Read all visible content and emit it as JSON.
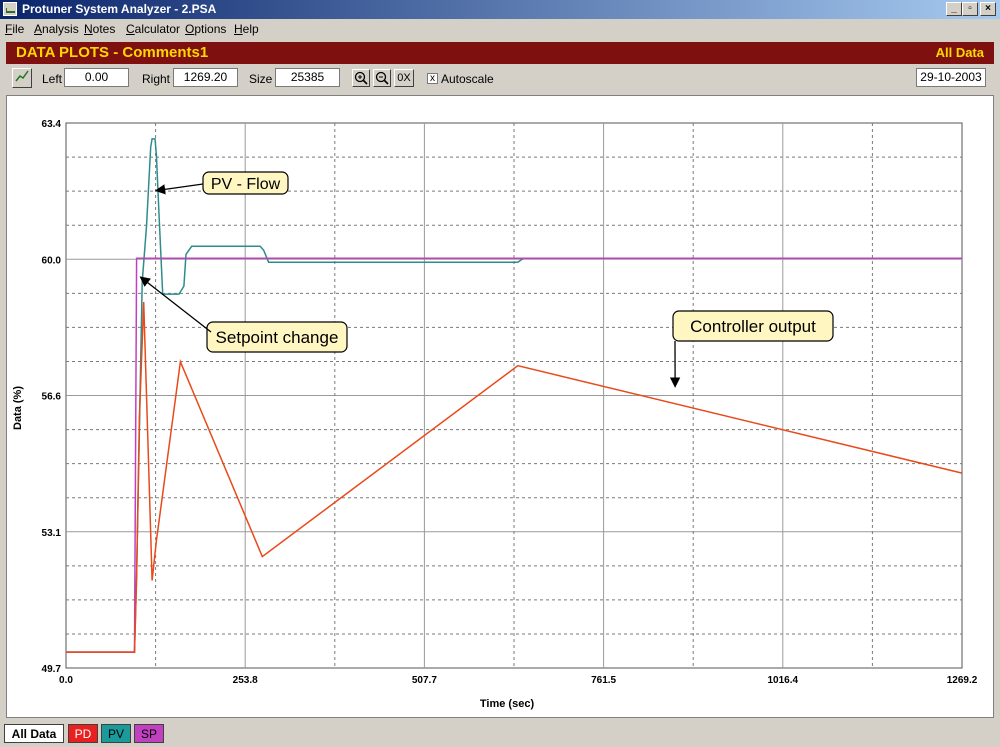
{
  "window": {
    "title": "Protuner System Analyzer - 2.PSA"
  },
  "menu": [
    "File",
    "Analysis",
    "Notes",
    "Calculator",
    "Options",
    "Help"
  ],
  "banner": {
    "title": "DATA PLOTS - Comments1",
    "right": "All Data"
  },
  "toolbar": {
    "left_label": "Left",
    "left_value": "0.00",
    "right_label": "Right",
    "right_value": "1269.20",
    "size_label": "Size",
    "size_value": "25385",
    "zoom_in": "+",
    "zoom_out": "-",
    "reset": "0X",
    "autoscale_checked": "x",
    "autoscale_label": "Autoscale",
    "date": "29-10-2003"
  },
  "tabs": [
    {
      "label": "All Data",
      "bg": "#ffffff",
      "fg": "#000000"
    },
    {
      "label": "PD",
      "bg": "#e82020",
      "fg": "#ffffff"
    },
    {
      "label": "PV",
      "bg": "#1a9a9a",
      "fg": "#000000"
    },
    {
      "label": "SP",
      "bg": "#c040c0",
      "fg": "#000000"
    }
  ],
  "chart_data": {
    "type": "line",
    "xlabel": "Time (sec)",
    "ylabel": "Data (%)",
    "xlim": [
      0,
      1269.2
    ],
    "ylim": [
      49.7,
      63.4
    ],
    "x_ticks": [
      "0.0",
      "253.8",
      "507.7",
      "761.5",
      "1016.4",
      "1269.2"
    ],
    "y_ticks": [
      "49.7",
      "53.1",
      "56.6",
      "60.0",
      "63.4"
    ],
    "grid": true,
    "series": [
      {
        "name": "PD",
        "color": "#e84a1a",
        "x": [
          0,
          97,
          100,
          104,
          110,
          122,
          128,
          162,
          278,
          640,
          1269.2
        ],
        "y": [
          50.1,
          50.1,
          52.0,
          56.0,
          58.9,
          51.9,
          52.9,
          57.4,
          52.5,
          57.3,
          54.6
        ]
      },
      {
        "name": "PV",
        "color": "#2f8c8c",
        "x": [
          0,
          97,
          100,
          108,
          114,
          120,
          122,
          124,
          126,
          128,
          132,
          137,
          160,
          167,
          170,
          178,
          205,
          275,
          280,
          287,
          300,
          640,
          648,
          1269.2
        ],
        "y": [
          50.1,
          50.1,
          52.0,
          59.4,
          60.8,
          62.8,
          63.0,
          63.0,
          63.0,
          62.6,
          61.0,
          59.1,
          59.1,
          59.3,
          60.1,
          60.3,
          60.3,
          60.3,
          60.2,
          59.9,
          59.9,
          59.9,
          60.0,
          60.0
        ]
      },
      {
        "name": "SP",
        "color": "#c040c0",
        "x": [
          0,
          97,
          100,
          1269.2
        ],
        "y": [
          50.1,
          50.1,
          60.0,
          60.0
        ]
      }
    ],
    "annotations": [
      {
        "text": "PV - Flow",
        "x": 122,
        "y": 61.7
      },
      {
        "text": "Setpoint change",
        "x": 100,
        "y": 59.6
      },
      {
        "text": "Controller output",
        "x": 860,
        "y": 56.7
      }
    ]
  }
}
